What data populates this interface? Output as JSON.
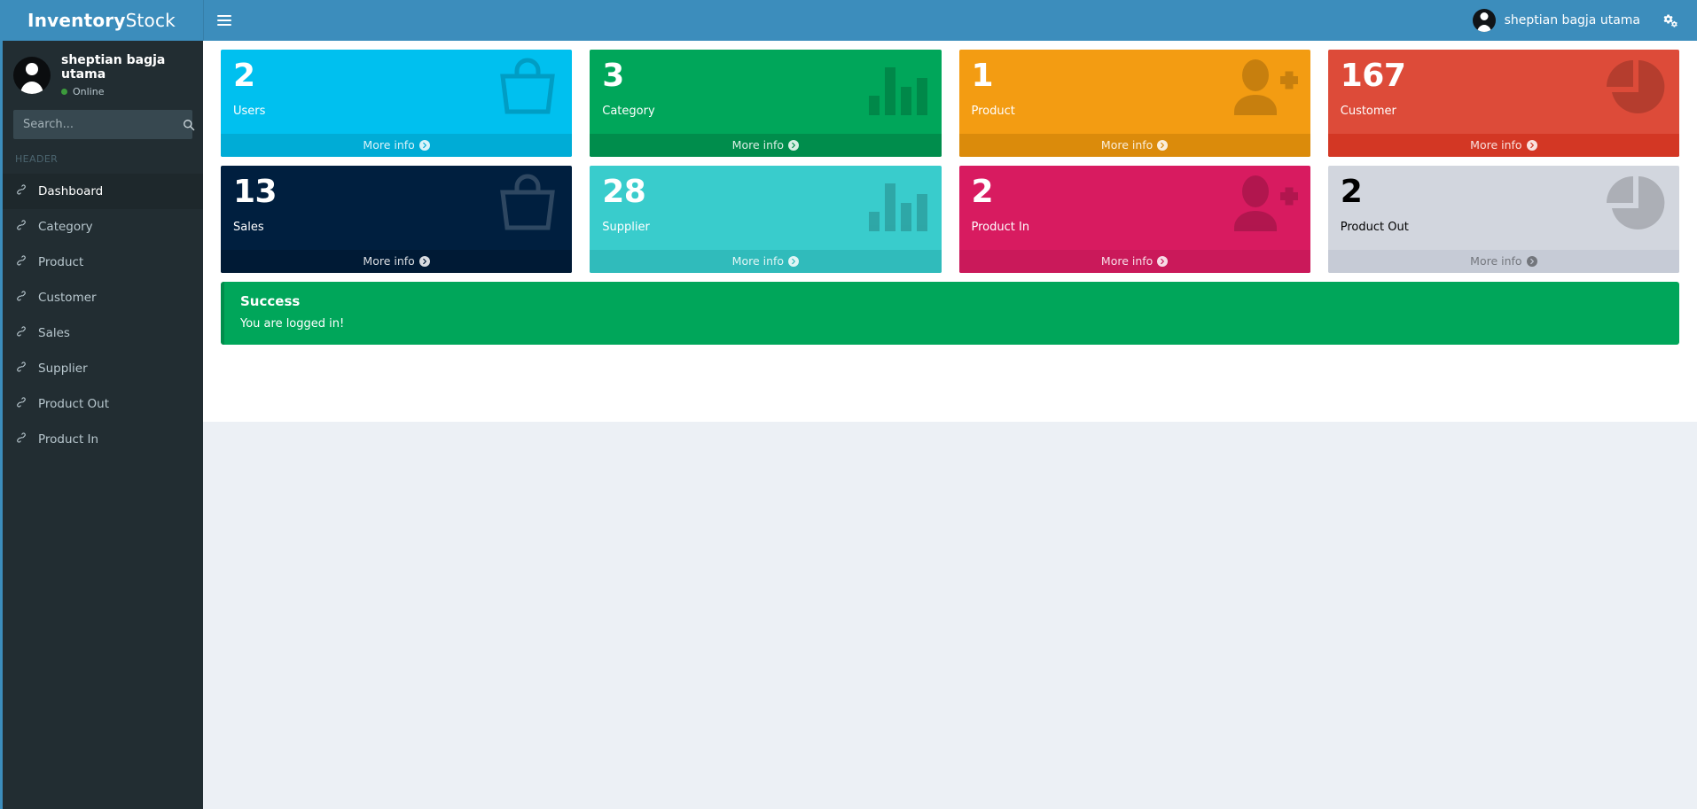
{
  "brand": {
    "bold": "Inventory",
    "thin": "Stock"
  },
  "navbar": {
    "menu_toggle_icon": "hamburger-icon",
    "user_name": "sheptian bagja utama",
    "settings_icon": "cogs-icon"
  },
  "sidebar": {
    "user": {
      "name": "sheptian bagja utama",
      "status": "Online"
    },
    "search": {
      "value": "",
      "placeholder": "Search...",
      "icon": "search-icon"
    },
    "menu_header": "HEADER",
    "items": [
      {
        "label": "Dashboard",
        "icon": "link-icon",
        "active": true
      },
      {
        "label": "Category",
        "icon": "link-icon",
        "active": false
      },
      {
        "label": "Product",
        "icon": "link-icon",
        "active": false
      },
      {
        "label": "Customer",
        "icon": "link-icon",
        "active": false
      },
      {
        "label": "Sales",
        "icon": "link-icon",
        "active": false
      },
      {
        "label": "Supplier",
        "icon": "link-icon",
        "active": false
      },
      {
        "label": "Product Out",
        "icon": "link-icon",
        "active": false
      },
      {
        "label": "Product In",
        "icon": "link-icon",
        "active": false
      }
    ]
  },
  "boxes": [
    {
      "value": "2",
      "label": "Users",
      "more": "More info",
      "icon": "shopping-bag-icon",
      "bg": "#00c0ef",
      "footer_bg": "#00acd6",
      "text": "light"
    },
    {
      "value": "3",
      "label": "Category",
      "more": "More info",
      "icon": "bar-chart-icon",
      "bg": "#00a65a",
      "footer_bg": "#008d4c",
      "text": "light"
    },
    {
      "value": "1",
      "label": "Product",
      "more": "More info",
      "icon": "user-plus-icon",
      "bg": "#f39c12",
      "footer_bg": "#db8b0b",
      "text": "light"
    },
    {
      "value": "167",
      "label": "Customer",
      "more": "More info",
      "icon": "pie-chart-icon",
      "bg": "#dd4b39",
      "footer_bg": "#d33724",
      "text": "light"
    },
    {
      "value": "13",
      "label": "Sales",
      "more": "More info",
      "icon": "shopping-bag-icon",
      "bg": "#001f3f",
      "footer_bg": "#001a35",
      "text": "light"
    },
    {
      "value": "28",
      "label": "Supplier",
      "more": "More info",
      "icon": "bar-chart-icon",
      "bg": "#39cccc",
      "footer_bg": "#30bbbb",
      "text": "light"
    },
    {
      "value": "2",
      "label": "Product In",
      "more": "More info",
      "icon": "user-plus-icon",
      "bg": "#d81b60",
      "footer_bg": "#ca195a",
      "text": "light"
    },
    {
      "value": "2",
      "label": "Product Out",
      "more": "More info",
      "icon": "pie-chart-icon",
      "bg": "#d2d6de",
      "footer_bg": "#c6cbd6",
      "text": "dark"
    }
  ],
  "alert": {
    "title": "Success",
    "message": "You are logged in!",
    "color": "#00a65a"
  }
}
